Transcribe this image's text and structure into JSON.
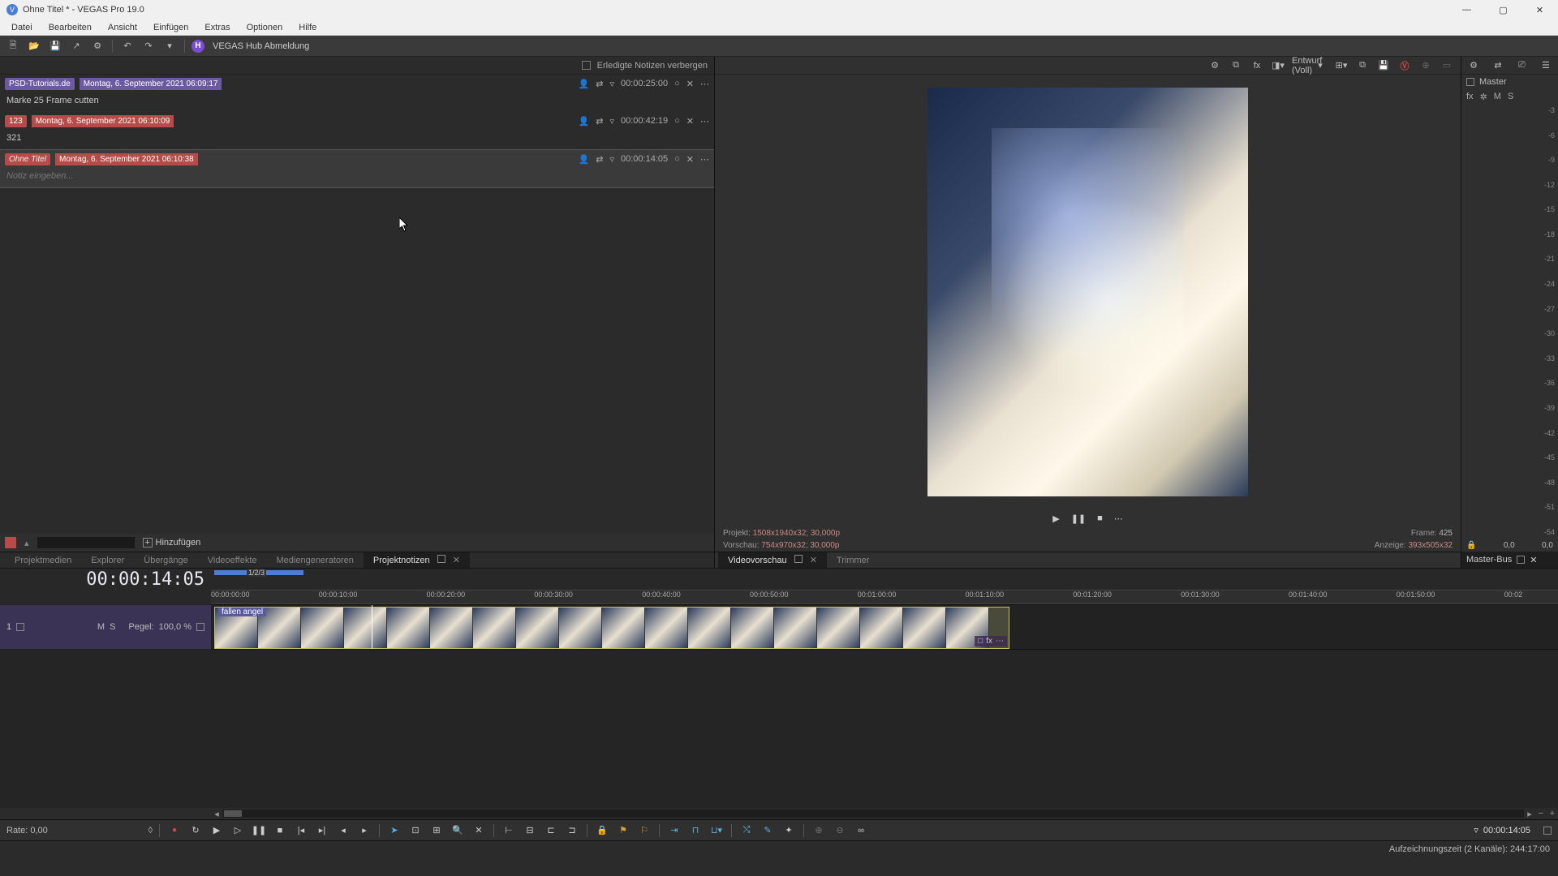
{
  "window": {
    "title": "Ohne Titel * - VEGAS Pro 19.0",
    "app_letter": "V"
  },
  "menu": [
    "Datei",
    "Bearbeiten",
    "Ansicht",
    "Einfügen",
    "Extras",
    "Optionen",
    "Hilfe"
  ],
  "hub": {
    "badge": "H",
    "label": "VEGAS Hub Abmeldung"
  },
  "notes_panel": {
    "hide_done_label": "Erledigte Notizen verbergen",
    "notes": [
      {
        "tag": "PSD-Tutorials.de",
        "tag_style": "purple",
        "date": "Montag, 6. September 2021 06:09:17",
        "time": "00:00:25:00",
        "body": "Marke 25 Frame cutten",
        "selected": false,
        "placeholder": false
      },
      {
        "tag": "123",
        "tag_style": "red",
        "date": "Montag, 6. September 2021 06:10:09",
        "time": "00:00:42:19",
        "body": "321",
        "selected": false,
        "placeholder": false
      },
      {
        "tag": "Ohne Titel",
        "tag_style": "red-i",
        "date": "Montag, 6. September 2021 06:10:38",
        "time": "00:00:14:05",
        "body": "Notiz eingeben...",
        "selected": true,
        "placeholder": true
      }
    ],
    "add_label": "Hinzufügen"
  },
  "tabs_lower_left": [
    {
      "label": "Projektmedien",
      "active": false
    },
    {
      "label": "Explorer",
      "active": false
    },
    {
      "label": "Übergänge",
      "active": false
    },
    {
      "label": "Videoeffekte",
      "active": false
    },
    {
      "label": "Mediengeneratoren",
      "active": false
    },
    {
      "label": "Projektnotizen",
      "active": true,
      "closable": true
    }
  ],
  "preview": {
    "quality_label": "Entwurf (Voll)",
    "project_k": "Projekt:",
    "project_v": "1508x1940x32; 30,000p",
    "vorschau_k": "Vorschau:",
    "vorschau_v": "754x970x32; 30,000p",
    "frame_k": "Frame:",
    "frame_v": "425",
    "anzeige_k": "Anzeige:",
    "anzeige_v": "393x505x32",
    "tabs": [
      {
        "label": "Videovorschau",
        "active": true,
        "closable": true
      },
      {
        "label": "Trimmer",
        "active": false
      }
    ]
  },
  "master": {
    "title": "Master",
    "fx": "fx",
    "settings": "✲",
    "m": "M",
    "s": "S",
    "scale": [
      "-3",
      "-6",
      "-9",
      "-12",
      "-15",
      "-18",
      "-21",
      "-24",
      "-27",
      "-30",
      "-33",
      "-36",
      "-39",
      "-42",
      "-45",
      "-48",
      "-51",
      "-54"
    ],
    "foot_l": "0,0",
    "foot_r": "0,0",
    "tab": "Master-Bus"
  },
  "timeline": {
    "big_time": "00:00:14:05",
    "ruler": [
      "00:00:00:00",
      "00:00:10:00",
      "00:00:20:00",
      "00:00:30:00",
      "00:00:40:00",
      "00:00:50:00",
      "00:01:00:00",
      "00:01:10:00",
      "00:01:20:00",
      "00:01:30:00",
      "00:01:40:00",
      "00:01:50:00",
      "00:02"
    ],
    "region_badge": "1/2/3",
    "track": {
      "num": "1",
      "m": "M",
      "s": "S",
      "pegel_k": "Pegel:",
      "pegel_v": "100,0 %"
    },
    "clip": {
      "label": "fallen angel",
      "tail_a": "□",
      "tail_b": "fx",
      "tail_c": "⋯"
    }
  },
  "bottom": {
    "rate": "Rate: 0,00",
    "time": "00:00:14:05"
  },
  "status": "Aufzeichnungszeit (2 Kanäle): 244:17:00"
}
